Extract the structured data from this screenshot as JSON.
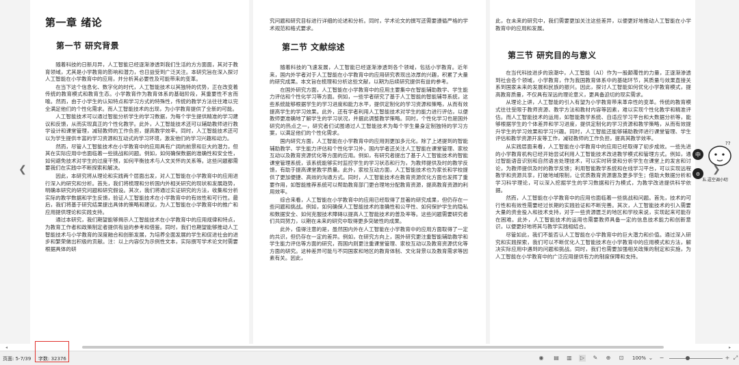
{
  "document": {
    "chapter_title": "第一章 绪论",
    "section1_title": "第一节 研究背景",
    "section1_paragraphs": [
      "随着科技的日新月异，人工智能已经逐渐渗透到我们生活的方方面面，其对于教育领域，尤其是小学教育的影响和潜力，也日益受到广泛关注。本研究旨在深入探讨人工智能在小学教育中的应用，并分析其必要性及可能带来的变革。",
      "在当下这个信息化、数字化的时代，人工智能技术以其独特的优势，正在改变着传统的教育模式和教育生态。小学教育作为教育体系的基础阶段，其重要性不言而喻。然而，由于小学生的认知特点和学习方式的特殊性，传统的教学方法往往难以完全满足他们的个性化需求。而人工智能技术的出现，为小学教育提供了全新的可能。",
      "人工智能技术可以通过智能分析学生的学习数据，为每个学生提供精准的学习建议和反馈，从而实现真正的个性化教学。此外，人工智能技术还可以辅助教师进行教学设计和课堂管理，减轻教师的工作负担，提高教学效率。同时，人工智能技术还可以为学生提供丰富的学习资源和互动式的学习环境，激发他们的学习兴趣和动力。",
      "然而，尽管人工智能技术在小学教育中的应用具有广阔的前景和巨大的潜力，但其在实际应用中也面临着一些挑战和问题。例如，如何确保数据的准确性和安全性，如何避免技术对学生的过度干预，如何平衡技术与人文关怀的关系等。这些问题都需要我们在实践中不断探索和解决。",
      "因此，本研究将从理论和实践两个层面出发，对人工智能在小学教育中的应用进行深入的研究和分析。首先，我们将梳理和分析国内外相关研究的现状和发展趋势，明确本研究的研究问题和研究假设。其次，我们将通过实证研究的方法，收集和分析实际的教学数据和学生反馈，验证人工智能技术在小学教育中的有效性和可行性。最后，我们将基于研究结果提出具体的策略和建议，为人工智能在小学教育中的推广和应用提供理论和实践支持。",
      "通过本研究，我们期望能够揭示人工智能技术在小学教育中的应用规律和特点，为教育工作者和政策制定者提供有益的参考和借鉴。同时，我们也期望能够推动人工智能技术与小学教育的深度融合和创新发展，为培养全面发展的学生和促进社会的进步和繁荣做出积极的贡献。注：以上内容仅为示例性文本，实际撰写学术论文时需要根据具体的研"
    ],
    "page2_intro": "究问题和研究目标进行详细的论述和分析。同时，学术论文的撰写还需要遵循严格的学术规范和格式要求。",
    "section2_title": "第二节 文献综述",
    "section2_paragraphs": [
      "随着科技的飞速发展，人工智能已经逐渐渗透到各个领域，包括小学教育。近年来，国内外学者对于人工智能在小学教育中的应用研究表现出浓厚的兴趣，积累了大量的研究成果。本文旨在梳理和分析这些文献，以期为后续研究提供有益的参考。",
      "在国外研究方面，人工智能在小学教育中的应用主要集中在智能辅助教学、学生能力评估和个性化学习等方面。例如，一些学者研究了基于人工智能的智能辅导系统，这些系统能够根据学生的学习进度和能力水平，提供定制化的学习资源和策略，从而有效提高学生的学习效果。此外，还有学者利用人工智能技术对学生的能力进行评估，以便教师更准确地了解学生的学习状况，并据此调整教学策略。同时，个性化学习也是国外研究的热点之一，研究者们试图通过人工智能技术为每个学生量身定制独特的学习方案，以满足他们的个性化需求。",
      "国内研究方面，人工智能在小学教育中的应用则更加多元化。除了上述提到的智能辅助教学、学生能力评估和个性化学习外，国内学者还关注人工智能在课堂管理、家校互动以及教育资源优化等方面的应用。例如，有研究者提出了基于人工智能技术的智能课堂管理系统，该系统能够实时监控学生的学习状态和行为，为教师提供及时的教学反馈，有助于提高课堂教学质量。此外，家校互动方面，人工智能技术也为家长和学校提供了更加便捷、高效的沟通方式。同时，人工智能技术在教育资源优化方面也发挥了重要作用，如智能推荐系统可以帮助教育部门更合理地分配教育资源，提高教育资源的利用效率。",
      "综合来看，人工智能在小学教育中的应用已经取得了显著的研究成果，但仍存在一些问题和挑战。例如，如何确保人工智能技术的准确性和公平性、如何保护学生的隐私和数据安全、如何克服技术障碍以提高人工智能技术的普及率等。这些问题需要研究者们共同努力，以期在未来的研究中取得更多突破性的成果。",
      "此外，值得注意的是，虽然国内外在人工智能在小学教育中的应用方面取得了一定的共识，但仍存在一定的差异。例如，在研究方向上，国外研究更注重智能辅助教学和学生能力评估等方面的研究，而国内则更注重课堂管理、家校互动以及教育资源优化等方面的研究。这种差异可能与不同国家和地区的教育体制、文化背景以及教育需求等因素有关。因此，"
    ],
    "page3_intro": "此，在未来的研究中，我们需要更加关注这些差异，以便更好地推动人工智能在小学教育中的应用和发展。",
    "section3_title": "第三节 研究目的与意义",
    "section3_paragraphs": [
      "在当代科技进步的浪潮中，人工智能（AI）作为一股颠覆性的力量，正逐渐渗透到社会各个领域，小学教育，作为我国教育体系中的基础环节，其质量与效果直接关系到国家未来的发展和民族的振兴。因此，探讨人工智能如何优化小学教育模式，提高教育质量，不仅具有深远的理论意义，更具备迫切的现实需求。",
      "从理论上讲，人工智能的引入有望为小学教育带来革命性的变革。传统的教育模式往往受限于教师资源、教学方法和教材内容等因素，难以实现个性化教学和精准评估。而人工智能技术的运用，如智能教学系统、自适应学习平台和大数据分析等，能够根据学生的个体差异和学习进度，提供定制化的学习资源和教学策略，从而有效提升学生的学习效果和学习兴趣。同时，人工智能还能够辅助教师进行课堂管理、学生评估和教学资源开发等工作，减轻教师的工作负担，提高其教学效率。",
      "从实践层面来看，人工智能在小学教育中的应用已经取得了初步成效。一些先进的小学教育机构已经开始尝试利用人工智能技术改进教学模式和管理方式。例如，通过智能语音识别和自然语言处理技术，可以实时转录和分析学生在课堂上的发言和讨论，为教师提供及时的教学反馈；利用智能教学系统和在线学习平台，可以实现远程教学和资源共享，打破地域限制，让优质教育资源惠及更多学生；借助大数据分析和学习科学理论，可以深入挖掘学生的学习数据和行为模式，为教学改进提供科学依据。",
      "然而，人工智能在小学教育中的应用也面临着一些挑战和问题。首先，技术的可行性和有效性需要经过长期的实践验证和不断完善。其次，人工智能技术的引入需要大量的资金投入和技术支持，对于一些资源匮乏的地区和学校来说，实现起来可能存在困难。此外，人工智能技术的运用也需要教师具备一定的信息技术能力和创新意识，以便更好地将其与教学实践相结合。",
      "尽管如此，我们不能否认人工智能在小学教育中的巨大潜力和价值。通过深入研究和实践探索，我们可以不断优化人工智能技术在小学教育中的应用模式和方法，解决实际应用中遇到的问题和挑战。同时，我们也需要加强相关政策的制定和实施，为人工智能在小学教育中的广泛应用提供有力的制度保障和支持。"
    ]
  },
  "status_bar": {
    "page_info": "页面: 5-7/39",
    "word_count": "字数: 32376",
    "zoom": "100%"
  },
  "avatar_caption": "五.逗空调小叨"
}
